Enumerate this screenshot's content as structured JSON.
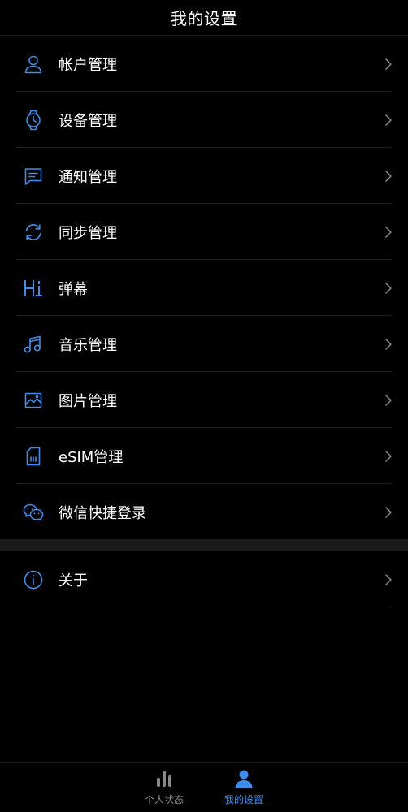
{
  "header": {
    "title": "我的设置"
  },
  "colors": {
    "accent": "#3b8ef0",
    "background": "#000000",
    "divider": "#1f1f1f",
    "tab_inactive": "#8a8a8a"
  },
  "settings": {
    "items": [
      {
        "label": "帐户管理",
        "icon": "user-icon"
      },
      {
        "label": "设备管理",
        "icon": "watch-icon"
      },
      {
        "label": "通知管理",
        "icon": "message-icon"
      },
      {
        "label": "同步管理",
        "icon": "sync-icon"
      },
      {
        "label": "弹幕",
        "icon": "hi-icon"
      },
      {
        "label": "音乐管理",
        "icon": "music-icon"
      },
      {
        "label": "图片管理",
        "icon": "image-icon"
      },
      {
        "label": "eSIM管理",
        "icon": "sim-card-icon"
      },
      {
        "label": "微信快捷登录",
        "icon": "wechat-icon"
      }
    ],
    "about": {
      "label": "关于",
      "icon": "info-icon"
    }
  },
  "tabbar": {
    "tabs": [
      {
        "label": "个人状态",
        "icon": "bar-chart-icon",
        "active": false
      },
      {
        "label": "我的设置",
        "icon": "user-icon",
        "active": true
      }
    ]
  }
}
